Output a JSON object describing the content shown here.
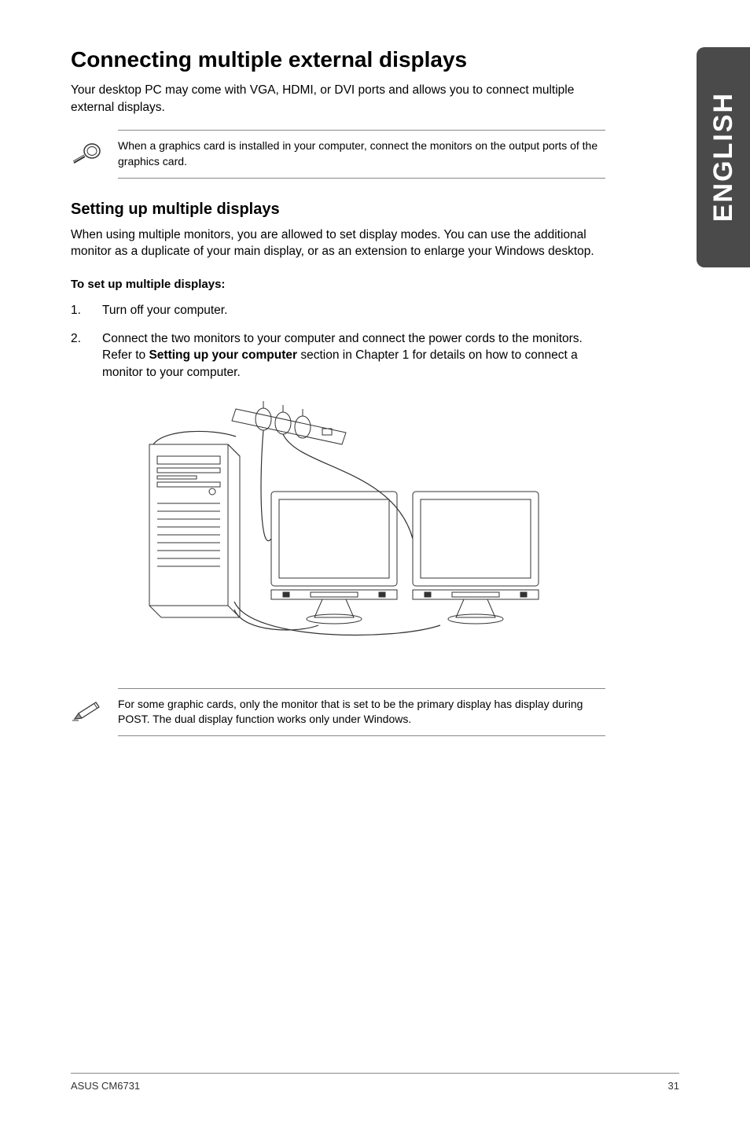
{
  "sideTab": "ENGLISH",
  "heading1": "Connecting multiple external displays",
  "intro": "Your desktop PC may come with VGA, HDMI, or DVI ports and allows you to connect multiple external displays.",
  "note1": "When a graphics card is installed in your computer, connect the monitors on the output ports of the graphics card.",
  "heading2": "Setting up multiple displays",
  "sectionText": "When using multiple monitors, you are allowed to set display modes. You can use the additional monitor as a duplicate of your main display, or as an extension to enlarge your Windows desktop.",
  "stepTitle": "To set up multiple displays:",
  "steps": [
    {
      "num": "1.",
      "text": "Turn off your computer."
    },
    {
      "num": "2.",
      "before": "Connect the two monitors to your computer and connect the power cords to the monitors. Refer to ",
      "bold": "Setting up your computer",
      "after": " section in Chapter 1 for details on how to connect a monitor to your computer."
    }
  ],
  "note2": "For some graphic cards, only the monitor that is set to be the primary display has display during POST. The dual display function works only under Windows.",
  "footer": {
    "left": "ASUS CM6731",
    "right": "31"
  }
}
